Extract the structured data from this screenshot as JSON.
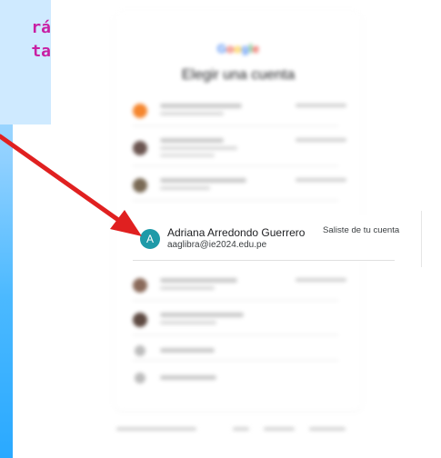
{
  "slide": {
    "text_line1": "rá",
    "text_line2": "ta"
  },
  "chooser": {
    "brand": "Google",
    "title": "Elegir una cuenta",
    "highlighted_account": {
      "avatar_letter": "A",
      "name": "Adriana Arredondo Guerrero",
      "email": "aaglibra@ie2024.edu.pe",
      "status": "Saliste de tu cuenta"
    }
  },
  "colors": {
    "slide_text": "#c81fa3",
    "arrow": "#e02020",
    "avatar": "#1e9aa8",
    "brand": [
      "#4285F4",
      "#EA4335",
      "#FBBC05",
      "#4285F4",
      "#34A853",
      "#EA4335"
    ]
  }
}
